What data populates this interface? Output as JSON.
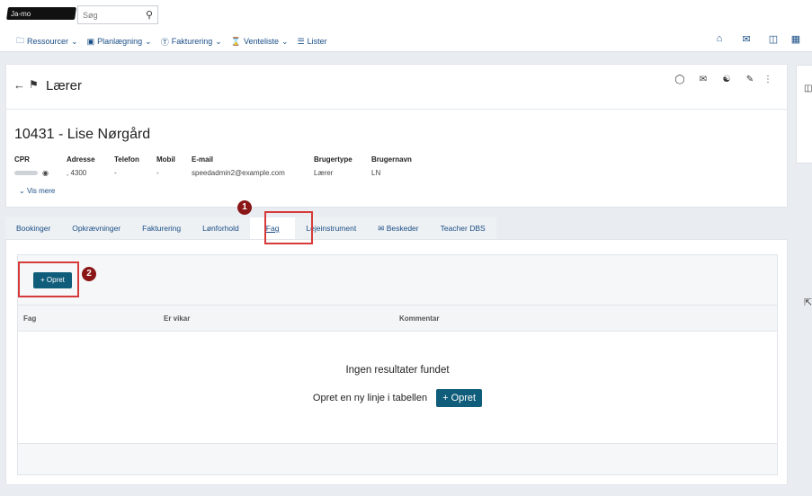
{
  "topbar": {
    "tenant_name": "Ja-mo",
    "search_placeholder": "Søg",
    "search_icon": "search-icon",
    "nav": [
      {
        "label": "Ressourcer",
        "icon": "folder-icon"
      },
      {
        "label": "Planlægning",
        "icon": "calendar-icon"
      },
      {
        "label": "Fakturering",
        "icon": "dollar-icon"
      },
      {
        "label": "Venteliste",
        "icon": "hourglass-icon"
      },
      {
        "label": "Lister",
        "icon": "list-icon"
      }
    ],
    "right_icons": [
      "home-icon",
      "mail-icon",
      "inbox-icon",
      "calendar-icon"
    ]
  },
  "card": {
    "role_title": "Lærer",
    "person_name": "10431 - Lise Nørgård",
    "actions": [
      "shield-icon",
      "mail-icon",
      "user-settings-icon",
      "edit-icon",
      "more-icon"
    ],
    "fields": [
      {
        "label": "CPR",
        "value": ""
      },
      {
        "label": "Adresse",
        "value": ", 4300"
      },
      {
        "label": "Telefon",
        "value": "-"
      },
      {
        "label": "Mobil",
        "value": "-"
      },
      {
        "label": "E-mail",
        "value": "speedadmin2@example.com"
      },
      {
        "label": "Brugertype",
        "value": "Lærer"
      },
      {
        "label": "Brugernavn",
        "value": "LN"
      }
    ],
    "vis_mere": "Vis mere"
  },
  "tabs": [
    {
      "label": "Bookinger",
      "active": false
    },
    {
      "label": "Opkrævninger",
      "active": false
    },
    {
      "label": "Fakturering",
      "active": false
    },
    {
      "label": "Lønforhold",
      "active": false
    },
    {
      "label": "Fag",
      "active": true
    },
    {
      "label": "Lejeinstrument",
      "active": false
    },
    {
      "label": "Beskeder",
      "active": false
    },
    {
      "label": "Teacher DBS",
      "active": false
    }
  ],
  "content": {
    "create_button": "+ Opret",
    "columns": [
      "Fag",
      "Er vikar",
      "Kommentar"
    ],
    "empty_title": "Ingen resultater fundet",
    "empty_prompt": "Opret en ny linje i tabellen",
    "empty_button": "+ Opret"
  },
  "annotations": {
    "step1": "1",
    "step2": "2",
    "color": "#d63a3a"
  }
}
